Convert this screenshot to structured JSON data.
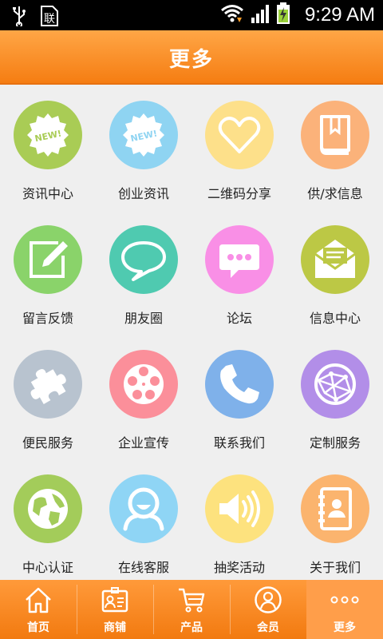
{
  "status_bar": {
    "time": "9:29 AM",
    "left_icons": [
      "usb-icon",
      "sim-icon"
    ],
    "right_icons": [
      "wifi-icon",
      "signal-icon",
      "battery-charging-icon"
    ]
  },
  "header": {
    "title": "更多"
  },
  "grid": [
    {
      "label": "资讯中心",
      "icon": "new-badge-icon",
      "color": "#a9cc55"
    },
    {
      "label": "创业资讯",
      "icon": "new-badge-icon",
      "color": "#8fd4f2"
    },
    {
      "label": "二维码分享",
      "icon": "heart-icon",
      "color": "#fde08a"
    },
    {
      "label": "供/求信息",
      "icon": "book-icon",
      "color": "#fbb27a"
    },
    {
      "label": "留言反馈",
      "icon": "edit-icon",
      "color": "#8ad36a"
    },
    {
      "label": "朋友圈",
      "icon": "chat-bubble-icon",
      "color": "#4fcab0"
    },
    {
      "label": "论坛",
      "icon": "message-icon",
      "color": "#f98fe6"
    },
    {
      "label": "信息中心",
      "icon": "envelope-icon",
      "color": "#bcc845"
    },
    {
      "label": "便民服务",
      "icon": "puzzle-icon",
      "color": "#b8c3cf"
    },
    {
      "label": "企业宣传",
      "icon": "film-reel-icon",
      "color": "#fb8f9a"
    },
    {
      "label": "联系我们",
      "icon": "phone-icon",
      "color": "#7fb1ea"
    },
    {
      "label": "定制服务",
      "icon": "globe-network-icon",
      "color": "#b28ee8"
    },
    {
      "label": "中心认证",
      "icon": "globe-icon",
      "color": "#a3cc5a"
    },
    {
      "label": "在线客服",
      "icon": "user-icon",
      "color": "#8fd5f5"
    },
    {
      "label": "抽奖活动",
      "icon": "speaker-icon",
      "color": "#fde27e"
    },
    {
      "label": "关于我们",
      "icon": "contacts-icon",
      "color": "#fbb46e"
    }
  ],
  "tabbar": {
    "tabs": [
      {
        "label": "首页",
        "icon": "home-icon"
      },
      {
        "label": "商铺",
        "icon": "shop-card-icon"
      },
      {
        "label": "产品",
        "icon": "cart-icon"
      },
      {
        "label": "会员",
        "icon": "member-icon"
      },
      {
        "label": "更多",
        "icon": "more-dots-icon",
        "active": true
      }
    ]
  }
}
